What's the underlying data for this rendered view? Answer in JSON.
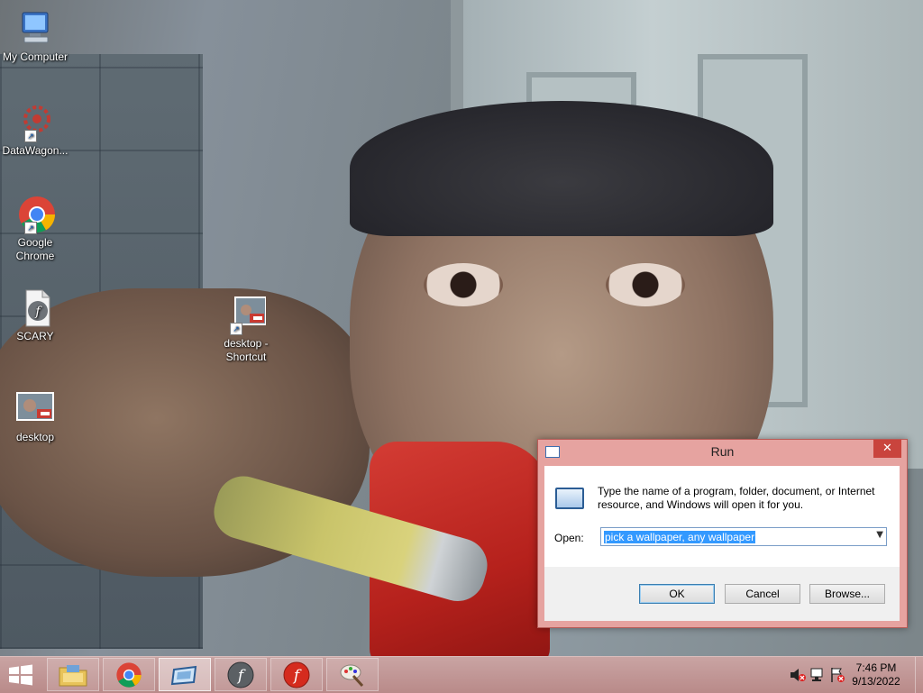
{
  "desktop": {
    "icons": [
      {
        "label": "My Computer",
        "icon": "my-computer-icon"
      },
      {
        "label": "DataWagon...",
        "icon": "datawagon-icon"
      },
      {
        "label": "Google Chrome",
        "icon": "chrome-icon"
      },
      {
        "label": "SCARY",
        "icon": "flash-file-icon"
      },
      {
        "label": "desktop - Shortcut",
        "icon": "image-shortcut-icon"
      },
      {
        "label": "desktop",
        "icon": "image-icon"
      }
    ]
  },
  "run_dialog": {
    "title": "Run",
    "close": "✕",
    "message": "Type the name of a program, folder, document, or Internet resource, and Windows will open it for you.",
    "open_label": "Open:",
    "input_value": "pick a wallpaper, any wallpaper",
    "buttons": {
      "ok": "OK",
      "cancel": "Cancel",
      "browse": "Browse..."
    }
  },
  "taskbar": {
    "items": [
      {
        "name": "file-explorer",
        "icon": "folder-icon"
      },
      {
        "name": "google-chrome",
        "icon": "chrome-icon"
      },
      {
        "name": "run",
        "icon": "run-icon",
        "active": true
      },
      {
        "name": "flash-player",
        "icon": "flash-icon"
      },
      {
        "name": "flash-player-red",
        "icon": "flash-red-icon"
      },
      {
        "name": "paint",
        "icon": "paint-icon"
      }
    ],
    "clock": {
      "time": "7:46 PM",
      "date": "9/13/2022"
    }
  },
  "colors": {
    "accent": "#e6a3a0",
    "close": "#c9443d",
    "taskbar": "#c29a99",
    "selection": "#3399ff"
  }
}
